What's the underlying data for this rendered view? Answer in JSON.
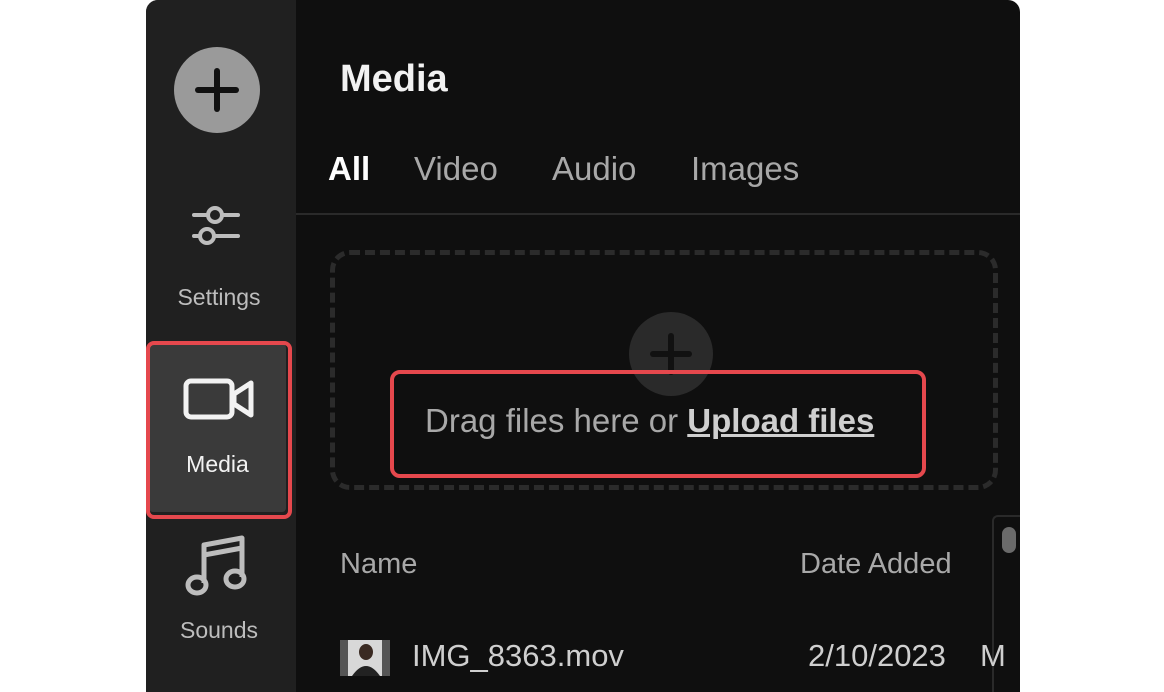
{
  "sidebar": {
    "items": [
      {
        "label": "Settings",
        "icon": "sliders-icon"
      },
      {
        "label": "Media",
        "icon": "video-camera-icon",
        "active": true
      },
      {
        "label": "Sounds",
        "icon": "music-note-icon"
      }
    ]
  },
  "header": {
    "title": "Media"
  },
  "tabs": [
    {
      "label": "All",
      "active": true
    },
    {
      "label": "Video"
    },
    {
      "label": "Audio"
    },
    {
      "label": "Images"
    }
  ],
  "dropzone": {
    "text": "Drag files here or ",
    "link_label": "Upload files"
  },
  "list": {
    "columns": [
      "Name",
      "Date Added"
    ],
    "rows": [
      {
        "name": "IMG_8363.mov",
        "date": "2/10/2023",
        "extra": "M"
      }
    ]
  },
  "colors": {
    "highlight": "#e5484d",
    "background": "#0f0f0f",
    "sidebar": "#202020"
  }
}
